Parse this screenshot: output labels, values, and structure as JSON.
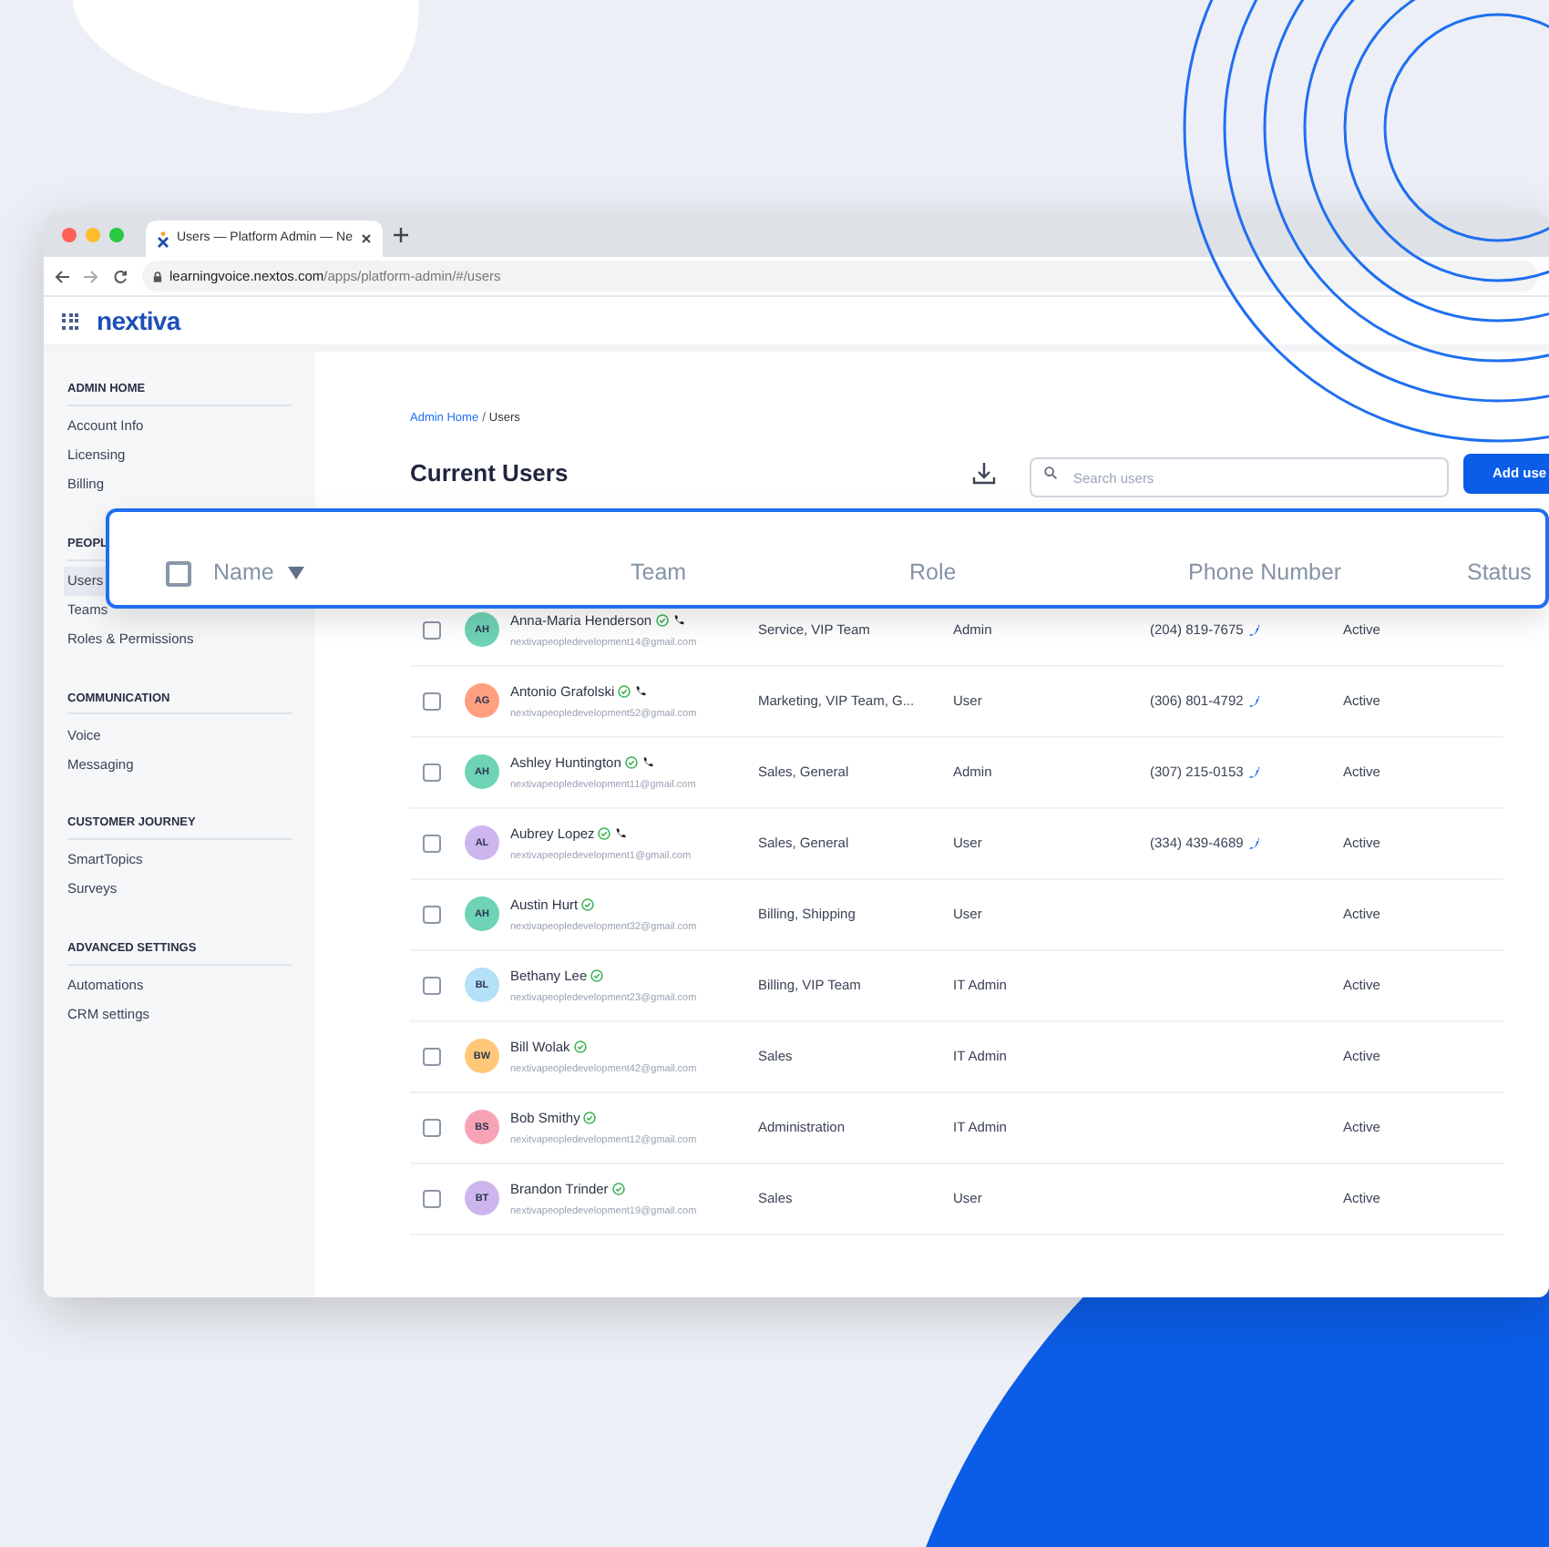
{
  "browser": {
    "tab_title": "Users — Platform Admin — Ne",
    "url_host": "learningvoice.nextos.com",
    "url_path": "/apps/platform-admin/#/users"
  },
  "app": {
    "logo": "nextiva"
  },
  "sidebar": [
    {
      "heading": "ADMIN HOME",
      "items": [
        {
          "label": "Account Info",
          "selected": false
        },
        {
          "label": "Licensing",
          "selected": false
        },
        {
          "label": "Billing",
          "selected": false
        }
      ]
    },
    {
      "heading": "PEOPL",
      "items": [
        {
          "label": "Users",
          "selected": true
        },
        {
          "label": "Teams",
          "selected": false
        },
        {
          "label": "Roles & Permissions",
          "selected": false
        }
      ]
    },
    {
      "heading": "COMMUNICATION",
      "items": [
        {
          "label": "Voice",
          "selected": false
        },
        {
          "label": "Messaging",
          "selected": false
        }
      ]
    },
    {
      "heading": "CUSTOMER JOURNEY",
      "items": [
        {
          "label": "SmartTopics",
          "selected": false
        },
        {
          "label": "Surveys",
          "selected": false
        }
      ]
    },
    {
      "heading": "ADVANCED SETTINGS",
      "items": [
        {
          "label": "Automations",
          "selected": false
        },
        {
          "label": "CRM settings",
          "selected": false
        }
      ]
    }
  ],
  "breadcrumb": {
    "link": "Admin Home",
    "separator": "/",
    "current": "Users"
  },
  "title": "Current Users",
  "search": {
    "placeholder": "Search users"
  },
  "add_button": "Add use",
  "header": {
    "checked": false,
    "columns": [
      {
        "label": "Name",
        "sorted": true
      },
      {
        "label": "Team",
        "sorted": false
      },
      {
        "label": "Role",
        "sorted": false
      },
      {
        "label": "Phone Number",
        "sorted": false
      },
      {
        "label": "Status",
        "sorted": false
      }
    ]
  },
  "rows": [
    {
      "checked": false,
      "initials": "AH",
      "color": "#6fd3b5",
      "name": "Anna-Maria Henderson",
      "verified": true,
      "calling": true,
      "email": "nextivapeopledevelopment14@gmail.com",
      "team": "Service, VIP Team",
      "role": "Admin",
      "phone": "(204) 819-7675",
      "status": "Active"
    },
    {
      "checked": false,
      "initials": "AG",
      "color": "#ff9f80",
      "name": "Antonio Grafolski",
      "verified": true,
      "calling": true,
      "email": "nextivapeopledevelopment52@gmail.com",
      "team": "Marketing, VIP Team, G...",
      "role": "User",
      "phone": "(306) 801-4792",
      "status": "Active"
    },
    {
      "checked": false,
      "initials": "AH",
      "color": "#6fd3b5",
      "name": "Ashley Huntington",
      "verified": true,
      "calling": true,
      "email": "nextivapeopledevelopment11@gmail.com",
      "team": "Sales, General",
      "role": "Admin",
      "phone": "(307) 215-0153",
      "status": "Active"
    },
    {
      "checked": false,
      "initials": "AL",
      "color": "#cdb6ee",
      "name": "Aubrey Lopez",
      "verified": true,
      "calling": true,
      "email": "nextivapeopledevelopment1@gmail.com",
      "team": "Sales, General",
      "role": "User",
      "phone": "(334) 439-4689",
      "status": "Active"
    },
    {
      "checked": false,
      "initials": "AH",
      "color": "#6fd3b5",
      "name": "Austin Hurt",
      "verified": true,
      "calling": false,
      "email": "nextivapeopledevelopment32@gmail.com",
      "team": "Billing, Shipping",
      "role": "User",
      "status": "Active"
    },
    {
      "checked": false,
      "initials": "BL",
      "color": "#b5e1f8",
      "name": "Bethany Lee",
      "verified": true,
      "calling": false,
      "email": "nextivapeopledevelopment23@gmail.com",
      "team": "Billing, VIP Team",
      "role": "IT Admin",
      "status": "Active"
    },
    {
      "checked": false,
      "initials": "BW",
      "color": "#ffc878",
      "name": "Bill Wolak",
      "verified": true,
      "calling": false,
      "email": "nextivapeopledevelopment42@gmail.com",
      "team": "Sales",
      "role": "IT Admin",
      "status": "Active"
    },
    {
      "checked": false,
      "initials": "BS",
      "color": "#f7a3b6",
      "name": "Bob Smithy",
      "verified": true,
      "calling": false,
      "email": "nexitvapeopledevelopment12@gmail.com",
      "team": "Administration",
      "role": "IT Admin",
      "status": "Active"
    },
    {
      "checked": false,
      "initials": "BT",
      "color": "#cdb6ee",
      "name": "Brandon Trinder",
      "verified": true,
      "calling": false,
      "email": "nextivapeopledevelopment19@gmail.com",
      "team": "Sales",
      "role": "User",
      "status": "Active"
    }
  ]
}
